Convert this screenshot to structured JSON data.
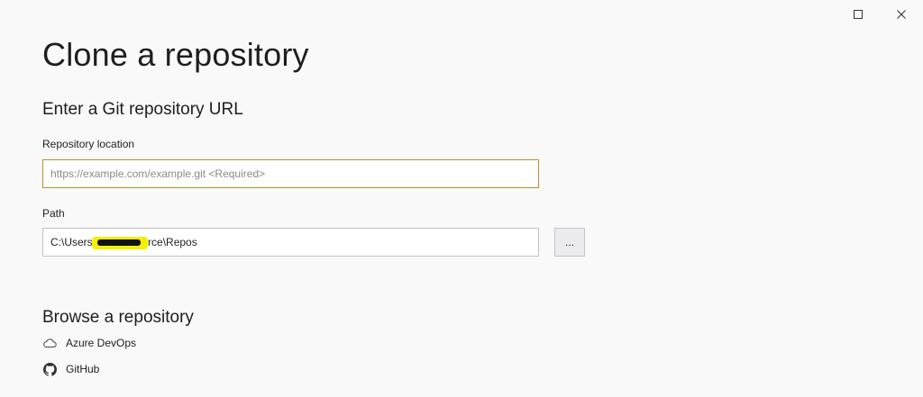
{
  "window": {
    "maximize_icon": "maximize-icon",
    "close_icon": "close-icon"
  },
  "page": {
    "title": "Clone a repository"
  },
  "url_section": {
    "heading": "Enter a Git repository URL",
    "repo_location_label": "Repository location",
    "repo_location_placeholder": "https://example.com/example.git <Required>",
    "repo_location_value": "",
    "path_label": "Path",
    "path_value": "C:\\Users\\          \\Source\\Repos",
    "browse_button_label": "..."
  },
  "browse_section": {
    "heading": "Browse a repository",
    "items": [
      {
        "label": "Azure DevOps",
        "icon": "cloud-icon"
      },
      {
        "label": "GitHub",
        "icon": "github-icon"
      }
    ]
  },
  "colors": {
    "background": "#f9f9fa",
    "focus_border": "#b8922e",
    "field_border": "#c2c3c9",
    "redaction_highlight": "#f4f000"
  }
}
